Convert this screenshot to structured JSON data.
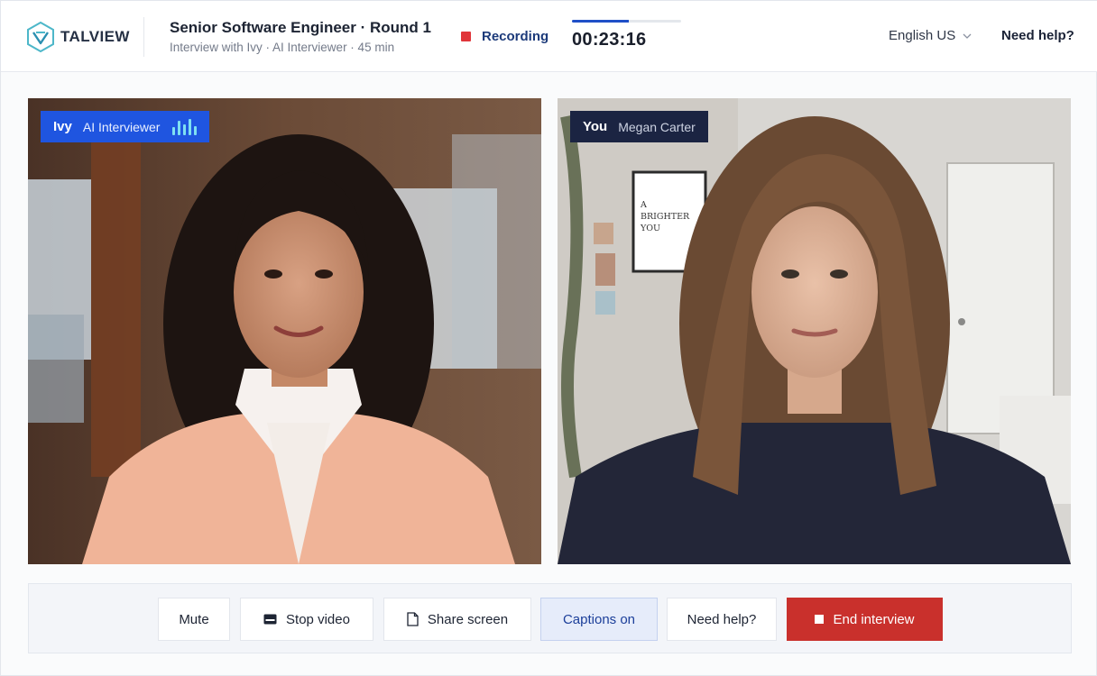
{
  "header": {
    "brand": "TALVIEW",
    "title": "Senior Software Engineer · Round 1",
    "subtitle": "Interview with Ivy · AI Interviewer · 45 min",
    "recording_label": "Recording",
    "timer": "00:23:16",
    "progress_fraction": 0.52,
    "language": "English US",
    "help_link": "Need help?"
  },
  "tiles": {
    "interviewer": {
      "name": "Ivy",
      "role": "AI Interviewer"
    },
    "candidate": {
      "name": "You",
      "role": "Megan Carter",
      "poster_text": "A BRIGHTER YOU"
    }
  },
  "controls": {
    "mute": "Mute",
    "stop_video": "Stop video",
    "share_screen": "Share screen",
    "captions": "Captions on",
    "need_help": "Need help?",
    "end_interview": "End interview"
  },
  "colors": {
    "accent": "#1f55e0",
    "recording": "#e0353a",
    "end": "#c9302c",
    "captions_bg": "#e6ecfa",
    "audio_bars": "#7ee0f2"
  },
  "icons": [
    "talview-logo-icon",
    "recording-dot-icon",
    "chevron-down-icon",
    "audio-level-icon",
    "video-icon",
    "document-icon",
    "stop-icon"
  ]
}
